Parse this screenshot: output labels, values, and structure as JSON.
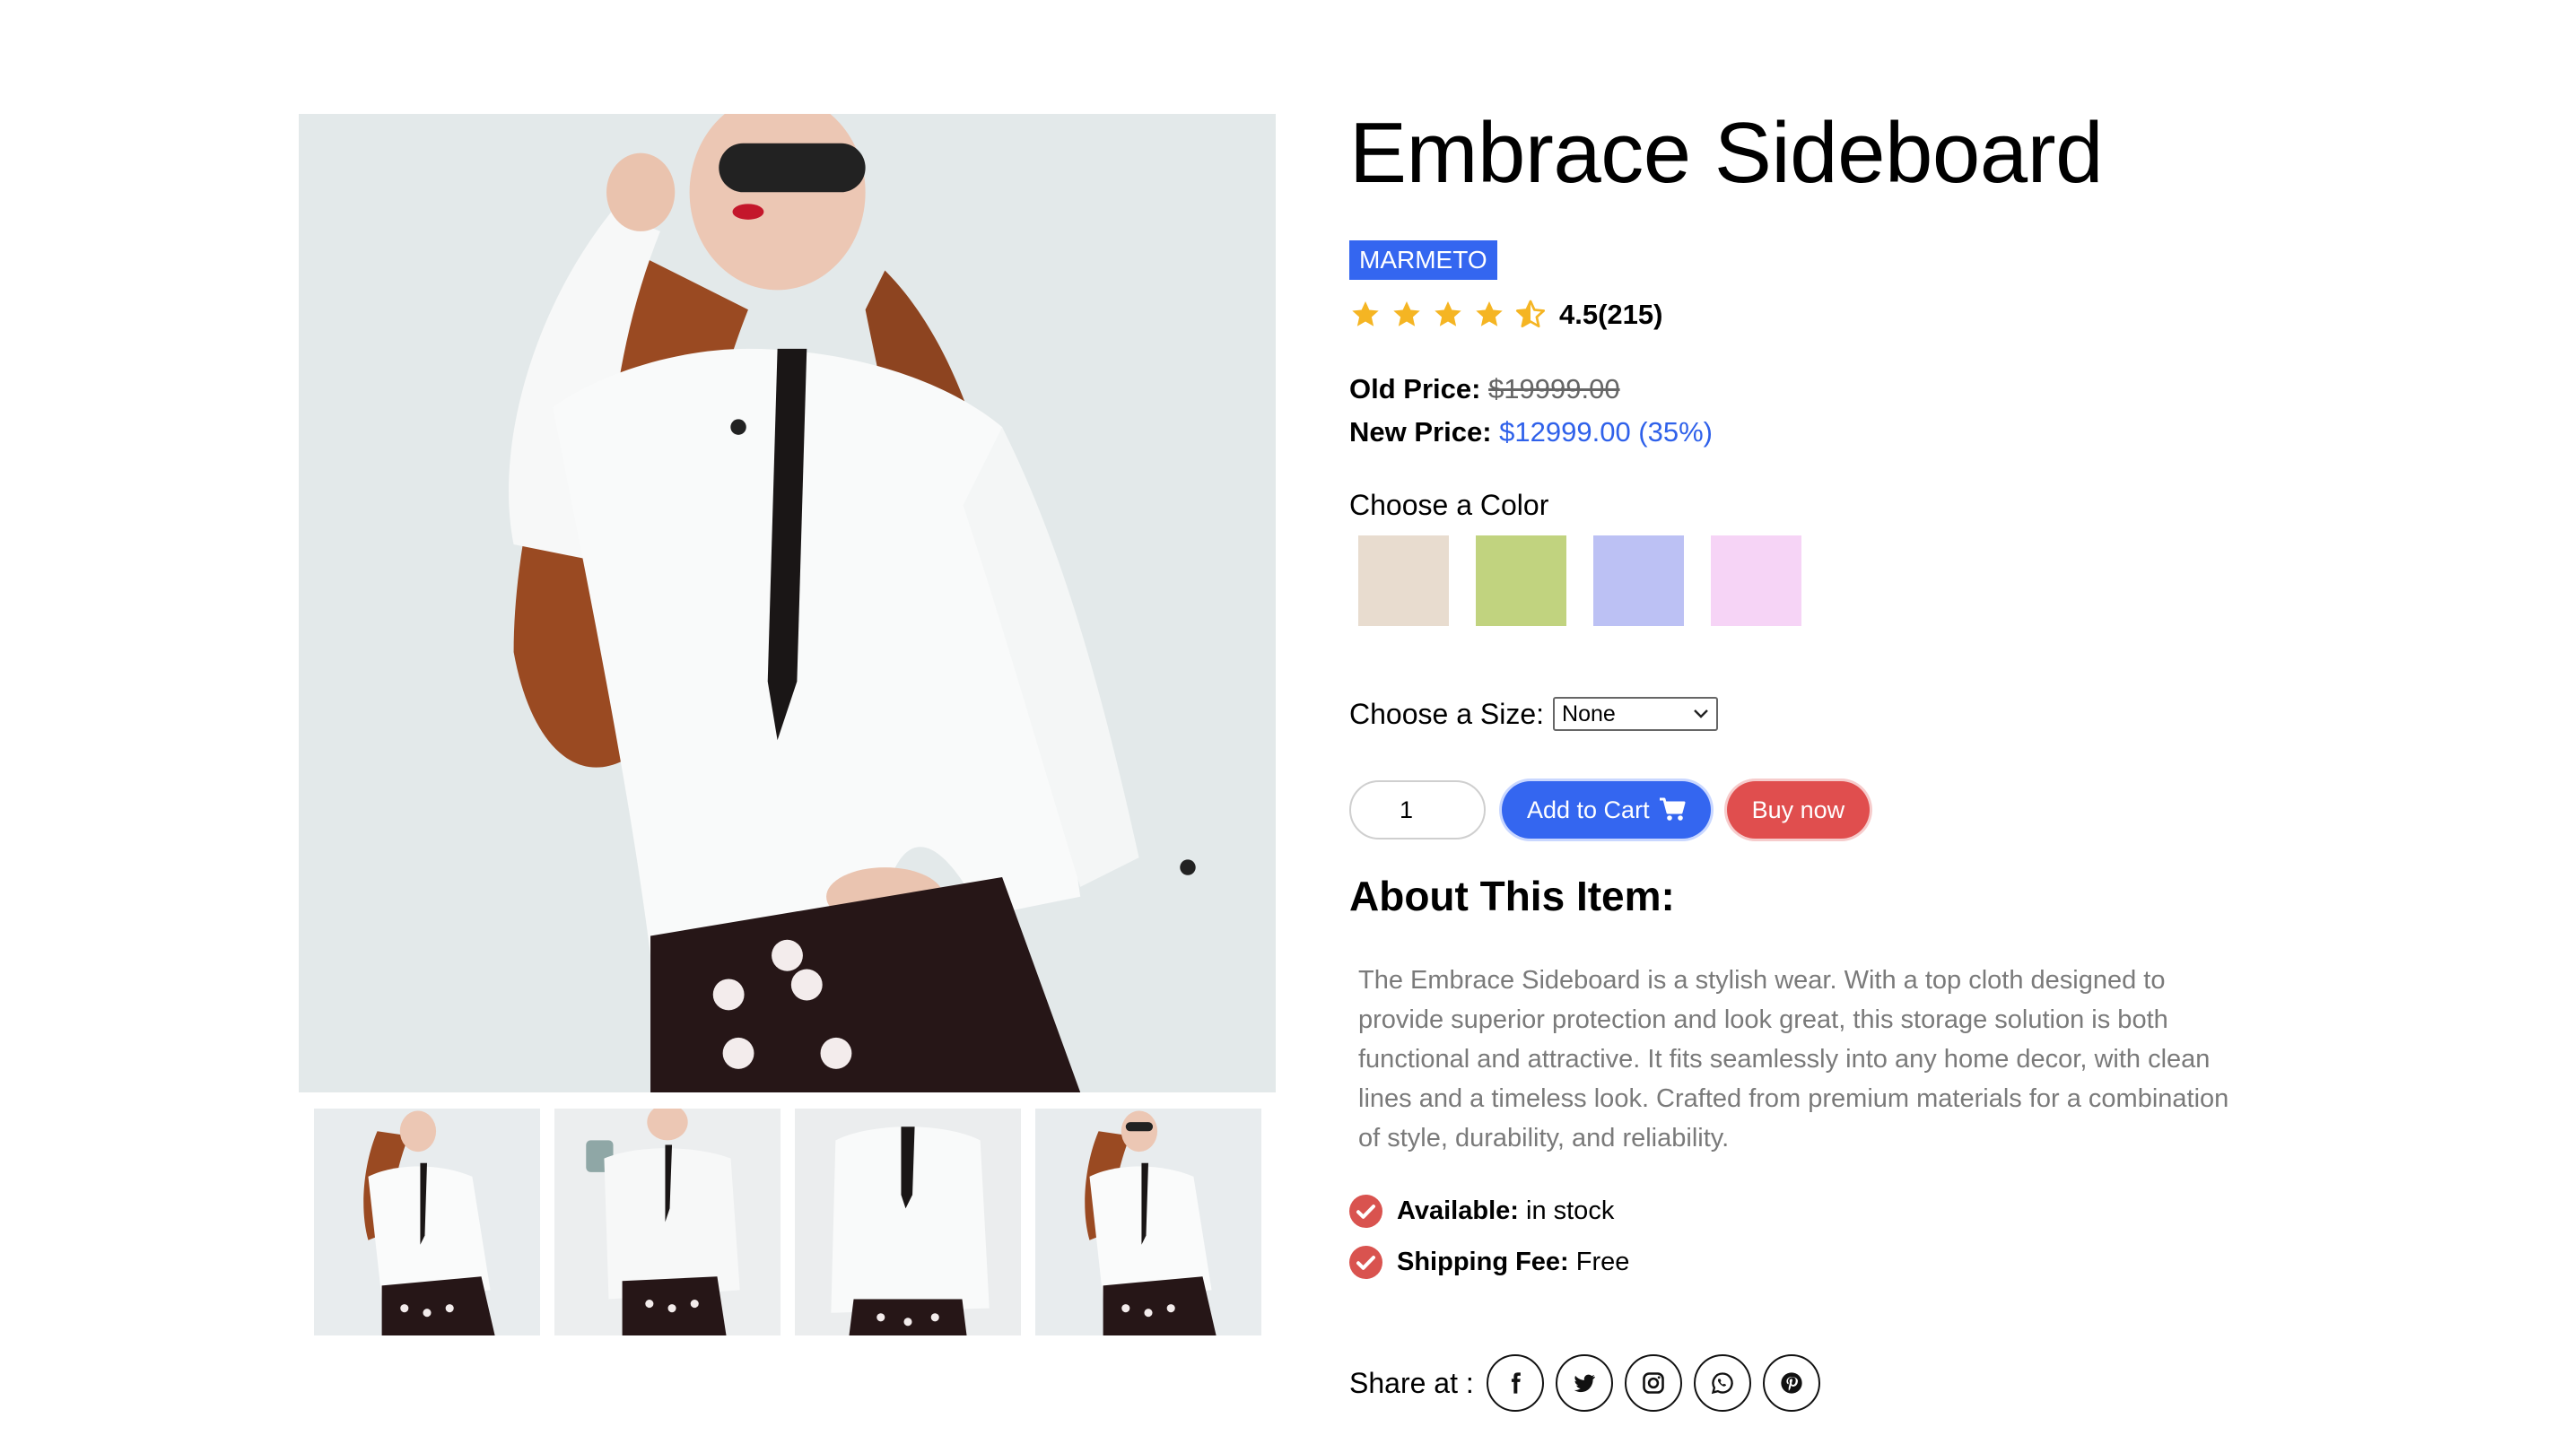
{
  "gallery": {
    "thumbnail_count": 4
  },
  "product": {
    "title": "Embrace Sideboard",
    "brand": "MARMETO",
    "rating": {
      "stars": 4.5,
      "text": "4.5(215)"
    },
    "old_price": {
      "label": "Old Price:",
      "value": "$19999.00"
    },
    "new_price": {
      "label": "New Price:",
      "value": "$12999.00 (35%)"
    }
  },
  "color": {
    "label": "Choose a Color",
    "swatches": [
      "#e8dccf",
      "#c1d37f",
      "#bcc1f4",
      "#f6d4f6"
    ]
  },
  "size": {
    "label": "Choose a Size:",
    "selected": "None"
  },
  "actions": {
    "quantity": "1",
    "add_to_cart": "Add to Cart",
    "buy_now": "Buy now"
  },
  "about": {
    "title": "About This Item:",
    "text": "The Embrace Sideboard is a stylish wear. With a top cloth designed to provide superior protection and look great, this storage solution is both functional and attractive. It fits seamlessly into any home decor, with clean lines and a timeless look. Crafted from premium materials for a combination of style, durability, and reliability."
  },
  "info": {
    "available_label": "Available:",
    "available_value": "in stock",
    "shipping_label": "Shipping Fee:",
    "shipping_value": "Free"
  },
  "share": {
    "label": "Share at :",
    "icons": [
      "facebook-icon",
      "twitter-icon",
      "instagram-icon",
      "whatsapp-icon",
      "pinterest-icon"
    ]
  },
  "colors": {
    "brand_bg": "#3466f0",
    "new_price": "#2f61ea",
    "buy_button": "#e04e4e",
    "star": "#f5b523",
    "check": "#d9534f",
    "description_text": "#7a7a7a"
  }
}
